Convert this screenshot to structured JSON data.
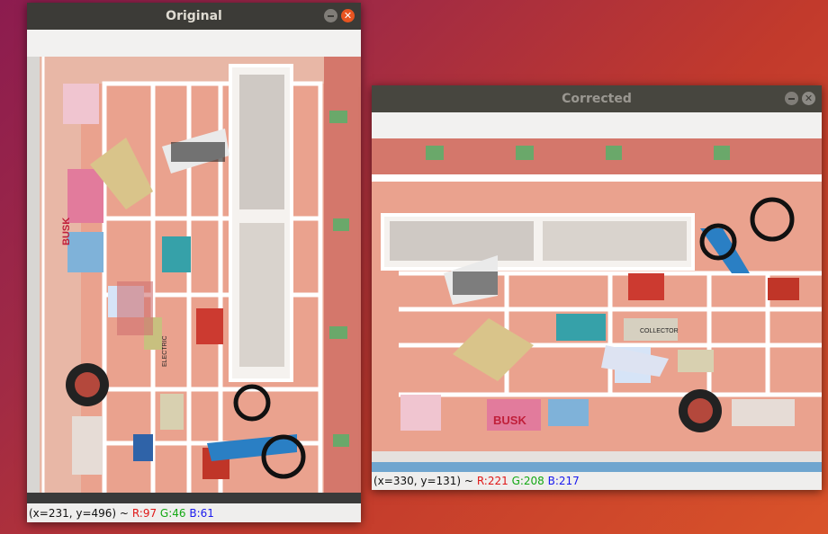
{
  "windows": {
    "original": {
      "title": "Original",
      "status": {
        "coords": "(x=231, y=496) ~",
        "r": "R:97",
        "g": "G:46",
        "b": "B:61"
      }
    },
    "corrected": {
      "title": "Corrected",
      "status": {
        "coords": "(x=330, y=131) ~",
        "r": "R:221",
        "g": "G:208",
        "b": "B:217"
      }
    }
  },
  "photo_labels": {
    "magazine": "BUSK",
    "electric": "ELECTRIC",
    "collector": "COLLECTOR"
  },
  "icons": {
    "minimize": "minimize-icon",
    "close": "close-icon"
  },
  "colors": {
    "accent": "#e95420",
    "titlebar": "#3c3b37",
    "shelf_wall": "#e8a795"
  }
}
